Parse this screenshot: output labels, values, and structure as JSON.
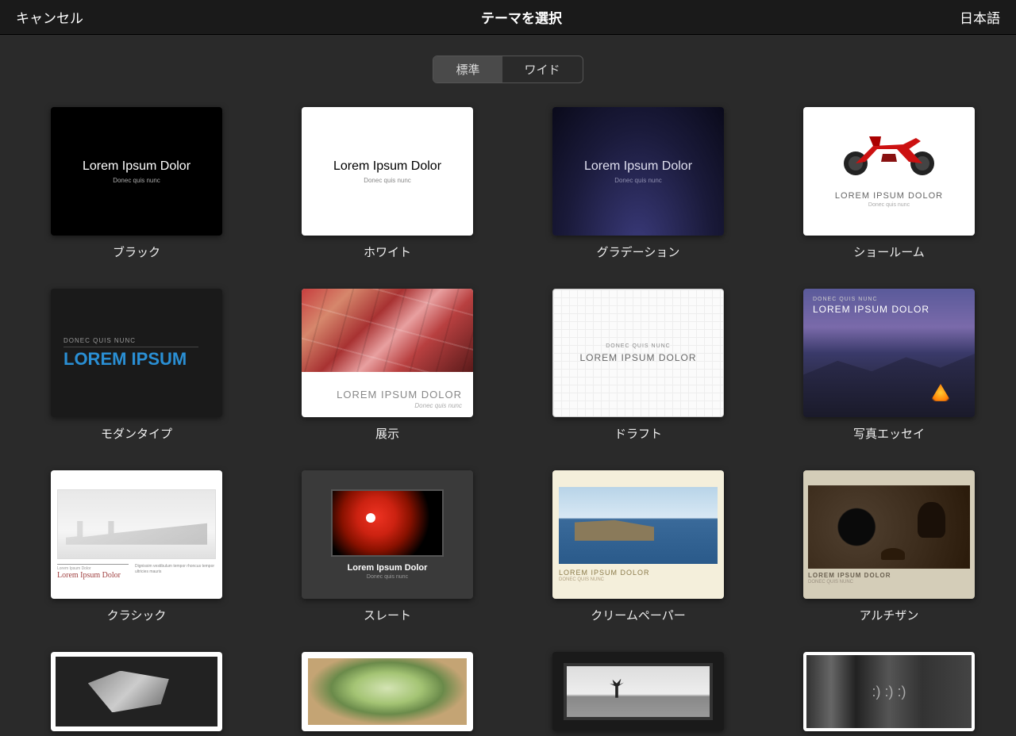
{
  "header": {
    "cancel": "キャンセル",
    "title": "テーマを選択",
    "language": "日本語"
  },
  "segmented": {
    "standard": "標準",
    "wide": "ワイド"
  },
  "placeholder": {
    "title": "Lorem Ipsum Dolor",
    "title_upper": "LOREM IPSUM DOLOR",
    "title_short": "LOREM IPSUM",
    "title_serif": "Lorem Ipsum Dolor",
    "sub": "Donec quis nunc",
    "sub_upper": "DONEC QUIS NUNC",
    "tiny": "Lorem Ipsum Dolor"
  },
  "themes": [
    {
      "label": "ブラック"
    },
    {
      "label": "ホワイト"
    },
    {
      "label": "グラデーション"
    },
    {
      "label": "ショールーム"
    },
    {
      "label": "モダンタイプ"
    },
    {
      "label": "展示"
    },
    {
      "label": "ドラフト"
    },
    {
      "label": "写真エッセイ"
    },
    {
      "label": "クラシック"
    },
    {
      "label": "スレート"
    },
    {
      "label": "クリームペーパー"
    },
    {
      "label": "アルチザン"
    }
  ]
}
